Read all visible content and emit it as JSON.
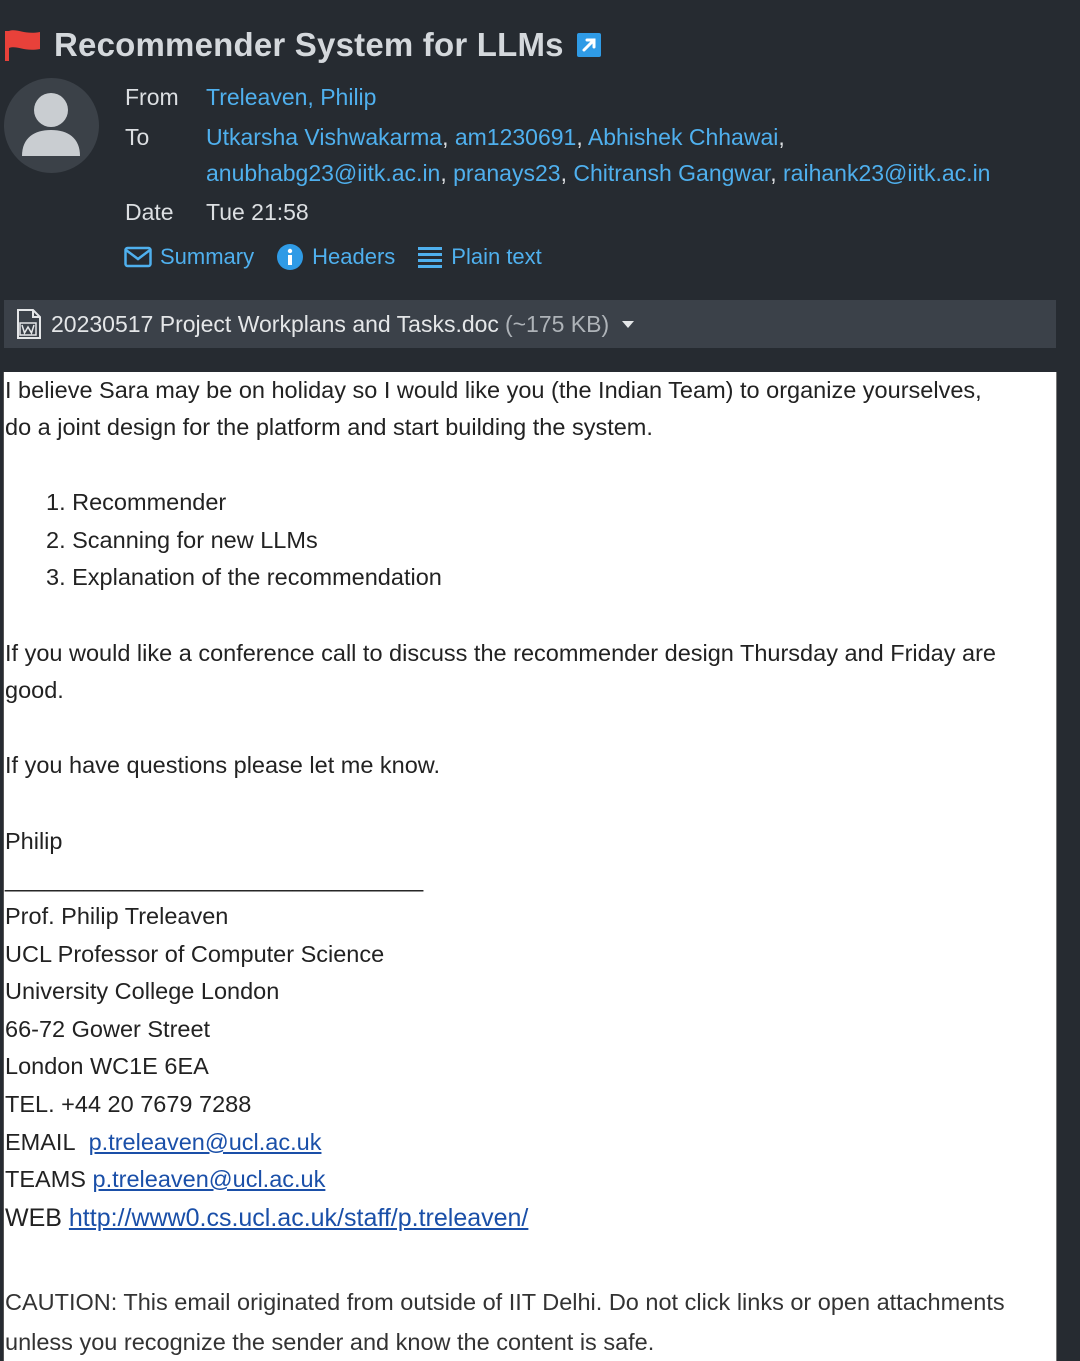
{
  "header": {
    "subject": "Recommender System for LLMs",
    "from_label": "From",
    "from_value": "Treleaven, Philip",
    "to_label": "To",
    "to_recipients": [
      "Utkarsha Vishwakarma",
      "am1230691",
      "Abhishek Chhawai",
      "anubhabg23@iitk.ac.in",
      "pranays23",
      "Chitransh Gangwar",
      "raihank23@iitk.ac.in"
    ],
    "date_label": "Date",
    "date_value": "Tue 21:58",
    "views": {
      "summary": "Summary",
      "headers": "Headers",
      "plain_text": "Plain text"
    }
  },
  "attachment": {
    "name": "20230517 Project Workplans and Tasks.doc",
    "size": "(~175 KB)"
  },
  "body": {
    "intro_line1": "I believe Sara may be on holiday so I would like you (the Indian Team) to organize yourselves,",
    "intro_line2": "do a joint design for the platform and start building the system.",
    "list": [
      "1. Recommender",
      "2. Scanning for new LLMs",
      "3. Explanation of the recommendation"
    ],
    "call_line1": "If you would like a conference call to discuss the recommender design Thursday and Friday are",
    "call_line2": "good.",
    "questions": "If you have questions please let me know.",
    "signoff": "Philip",
    "rule": "________________________________",
    "sig_name": "Prof. Philip Treleaven",
    "sig_title": "UCL Professor of Computer Science",
    "sig_org": "University College London",
    "sig_street": "66-72 Gower Street",
    "sig_city": "London WC1E 6EA",
    "sig_tel": "TEL. +44 20 7679 7288",
    "email_label": "EMAIL",
    "email_value": "p.treleaven@ucl.ac.uk",
    "teams_label": "TEAMS",
    "teams_value": "p.treleaven@ucl.ac.uk",
    "web_label": "WEB",
    "web_value": "http://www0.cs.ucl.ac.uk/staff/p.treleaven/",
    "caution_line1": "CAUTION: This email originated from outside of IIT Delhi. Do not click links or open attachments",
    "caution_line2": "unless you recognize the sender and know the content is safe."
  },
  "colors": {
    "link": "#4fb0ee",
    "flag": "#e8413a",
    "body_link": "#1a4fa8",
    "background": "#262b31"
  }
}
